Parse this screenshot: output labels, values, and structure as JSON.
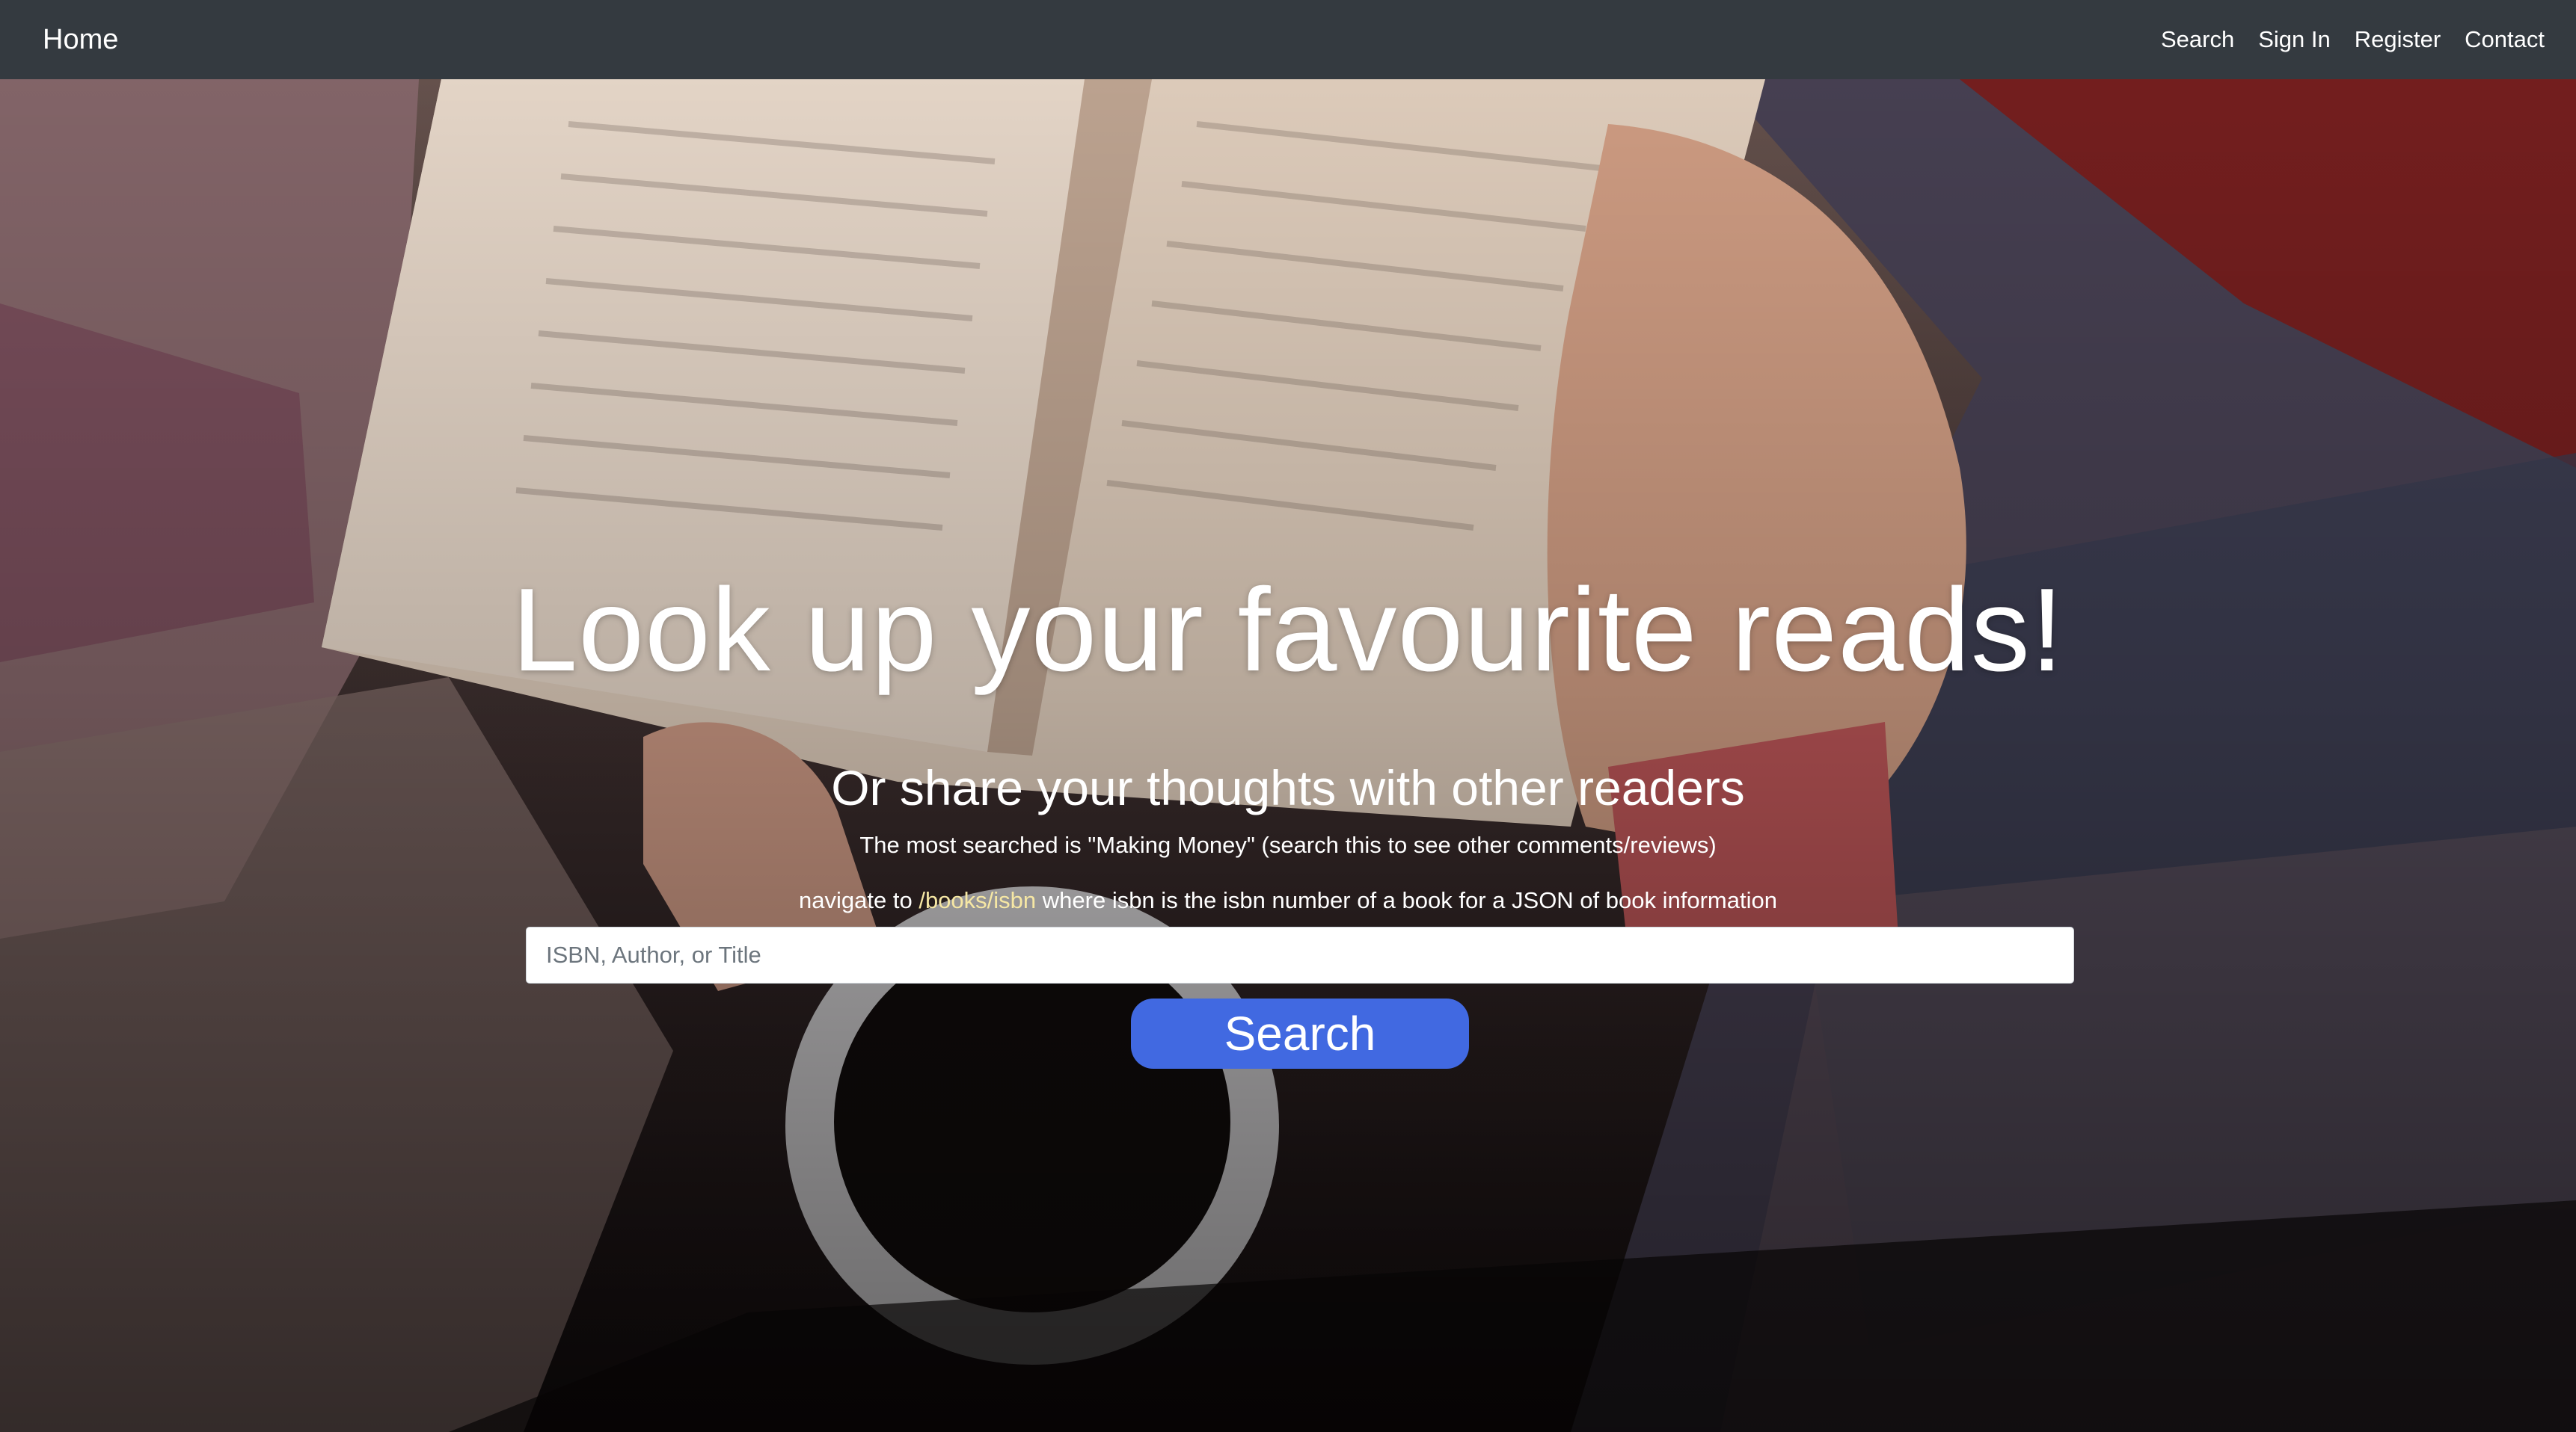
{
  "navbar": {
    "brand": "Home",
    "links": [
      "Search",
      "Sign In",
      "Register",
      "Contact"
    ]
  },
  "hero": {
    "headline": "Look up your favourite reads!",
    "subheadline": "Or share your thoughts with other readers",
    "most_searched_note": "The most searched is \"Making Money\" (search this to see other comments/reviews)",
    "api_prefix": "navigate to",
    "api_path": "/books/isbn",
    "api_suffix": "where isbn is the isbn number of a book for a JSON of book information"
  },
  "search": {
    "placeholder": "ISBN, Author, or Title",
    "value": "",
    "button_label": "Search"
  },
  "colors": {
    "navbar_bg": "#343a40",
    "button_bg": "#4169e1",
    "link_accent": "#f6e7a4"
  }
}
